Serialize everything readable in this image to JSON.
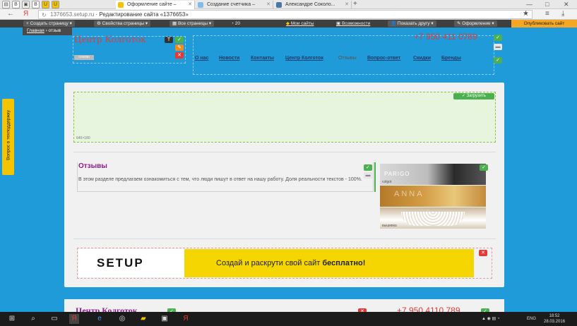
{
  "browser": {
    "tabs": [
      {
        "label": "Оформление сайте –",
        "icon_color": "#f5c400"
      },
      {
        "label": "Создание счетчика –",
        "icon_color": "#7fbde8"
      },
      {
        "label": "Александре Соколо...",
        "icon_color": "#4a76a8"
      }
    ],
    "pinned_icons": [
      "bookmark",
      "b",
      "photo",
      "vk",
      "u",
      "u"
    ],
    "new_tab_symbol": "+",
    "window_controls": [
      "—",
      "□",
      "✕"
    ],
    "url_domain": "1376653.setup.ru",
    "url_title": "Редактирование сайта «1376653»",
    "back": "←",
    "ya": "Я"
  },
  "editor": {
    "create_page": "Создать страницу",
    "page_props": "Свойства страницы",
    "all_pages": "Все страницы",
    "views": "20",
    "my_sites": "Мои сайты",
    "abilities": "Возможности",
    "show_friend": "Показать другу",
    "design": "Оформление",
    "publish": "Опубликовать сайт"
  },
  "breadcrumb": {
    "home": "Главная",
    "sep": "›",
    "current": "отзыв"
  },
  "site": {
    "logo": "Центр Колготок",
    "slogan_placeholder": "слоган",
    "phone": "+7 950 411 0789",
    "menu": [
      "О нас",
      "Новости",
      "Контакты",
      "Центр Колготок",
      "Отзывы",
      "Вопрос-ответ",
      "Скидки",
      "Бренды"
    ],
    "menu_current_index": 4
  },
  "banner": {
    "upload_label": "Загрузить",
    "size_label": "640×180"
  },
  "reviews": {
    "title": "Отзывы",
    "text": "В этом разделе предлагаем ознакомиться с тем, что люди пишут в ответ на нашу работу. Доля реальности текстов - 100%."
  },
  "photos": [
    {
      "brand": "PARIGO",
      "caption": "colgot"
    },
    {
      "brand": "ANNA",
      "caption": ""
    },
    {
      "brand": "",
      "caption": "вышивка"
    }
  ],
  "ad": {
    "brand": "SETUP",
    "slogan_start": "Создай и раскрути свой сайт ",
    "slogan_bold": "бесплатно!"
  },
  "footer_preview": {
    "logo": "Центр Колготок",
    "phone": "+7 950 4110 789"
  },
  "support_tab": "Вопрос в техподдержку",
  "taskbar": {
    "lang": "ENG",
    "time": "18:52",
    "date": "28.03.2016"
  },
  "controls": {
    "check": "✓",
    "close": "✕",
    "text": "T",
    "edit": "✎"
  }
}
